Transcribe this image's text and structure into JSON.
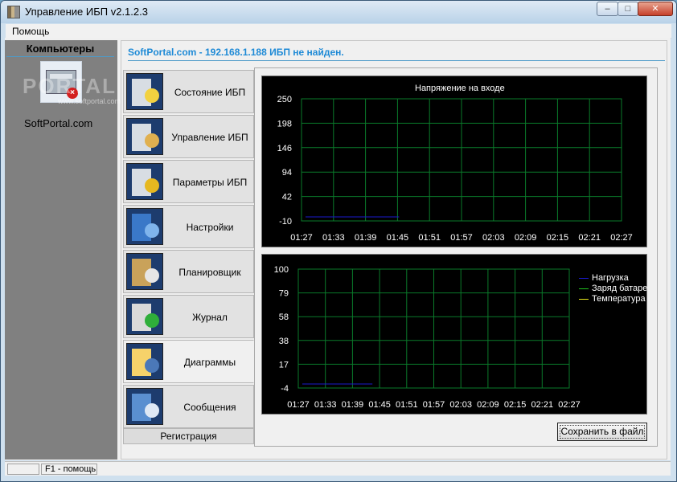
{
  "window": {
    "title": "Управление ИБП v2.1.2.3",
    "min": "–",
    "max": "□",
    "close": "✕"
  },
  "menu": {
    "help": "Помощь"
  },
  "left_panel": {
    "header": "Компьютеры",
    "computer_label": "SoftPortal.com",
    "watermark": "PORTAL",
    "watermark_sub": "www.softportal.com"
  },
  "status_message": "SoftPortal.com - 192.168.1.188 ИБП не найден.",
  "nav": [
    {
      "label": "Состояние ИБП",
      "icon": "ups-status-icon"
    },
    {
      "label": "Управление ИБП",
      "icon": "ups-control-icon"
    },
    {
      "label": "Параметры ИБП",
      "icon": "ups-parameters-icon"
    },
    {
      "label": "Настройки",
      "icon": "settings-gear-icon"
    },
    {
      "label": "Планировщик",
      "icon": "scheduler-clock-icon"
    },
    {
      "label": "Журнал",
      "icon": "journal-printer-icon"
    },
    {
      "label": "Диаграммы",
      "icon": "diagram-chart-icon"
    },
    {
      "label": "Сообщения",
      "icon": "messages-envelope-icon"
    }
  ],
  "active_nav_index": 6,
  "registration": "Регистрация",
  "save_button": "Сохранить в файл",
  "statusbar": {
    "pane1": "",
    "pane2": "F1 - помощь"
  },
  "colors": {
    "grid": "#0a7a2a",
    "series_load": "#1a1acc",
    "series_battery": "#1fbf1f",
    "series_temperature": "#e8e81a",
    "status_text": "#1e8ad6"
  },
  "chart_data": [
    {
      "type": "line",
      "title": "Напряжение на входе",
      "y_ticks": [
        "250",
        "198",
        "146",
        "94",
        "42",
        "-10"
      ],
      "x_ticks": [
        "01:27",
        "01:33",
        "01:39",
        "01:45",
        "01:51",
        "01:57",
        "02:03",
        "02:09",
        "02:15",
        "02:21",
        "02:27"
      ],
      "ylim": [
        -10,
        250
      ],
      "grid": true,
      "series": [
        {
          "values": [
            {
              "x": "01:27",
              "y": -10
            },
            {
              "x": "01:45",
              "y": -10
            }
          ]
        }
      ]
    },
    {
      "type": "line",
      "title": "",
      "y_ticks": [
        "100",
        "79",
        "58",
        "38",
        "17",
        "-4"
      ],
      "x_ticks": [
        "01:27",
        "01:33",
        "01:39",
        "01:45",
        "01:51",
        "01:57",
        "02:03",
        "02:09",
        "02:15",
        "02:21",
        "02:27"
      ],
      "ylim": [
        -4,
        100
      ],
      "grid": true,
      "legend": [
        "Нагрузка",
        "Заряд батаре",
        "Температура"
      ],
      "legend_position": "right",
      "series": [
        {
          "name": "Нагрузка",
          "values": [
            {
              "x": "01:27",
              "y": -4
            },
            {
              "x": "01:43",
              "y": -4
            }
          ]
        },
        {
          "name": "Заряд батаре",
          "values": []
        },
        {
          "name": "Температура",
          "values": []
        }
      ]
    }
  ]
}
